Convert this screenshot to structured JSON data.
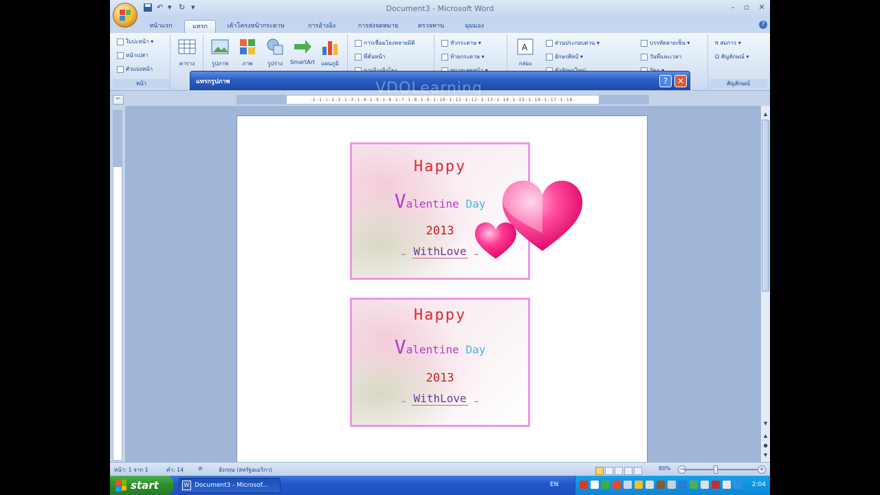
{
  "window": {
    "title": "Document3 - Microsoft Word",
    "minimize": "–",
    "maximize": "▫",
    "close": "✕"
  },
  "qat": {
    "save_icon": "save-icon",
    "undo": "↶",
    "redo": "↻",
    "more": "▾"
  },
  "tabs": [
    {
      "label": "หน้าแรก"
    },
    {
      "label": "แทรก",
      "active": true
    },
    {
      "label": "เค้าโครงหน้ากระดาษ"
    },
    {
      "label": "การอ้างอิง"
    },
    {
      "label": "การส่งจดหมาย"
    },
    {
      "label": "ตรวจทาน"
    },
    {
      "label": "มุมมอง"
    }
  ],
  "ribbon": {
    "pages": {
      "items": [
        "ใบปะหน้า ▾",
        "หน้าเปล่า",
        "ตัวแบ่งหน้า"
      ],
      "label": "หน้า"
    },
    "table": {
      "label": "ตาราง"
    },
    "illustrations": {
      "items": [
        "รูปภาพ",
        "ภาพ",
        "รูปร่าง",
        "SmartArt",
        "แผนภูมิ"
      ]
    },
    "links": {
      "items": [
        "การเชื่อมโยงหลายมิติ",
        "ที่คั่นหน้า",
        "การอ้างอิงโยง"
      ]
    },
    "header_footer": {
      "items": [
        "หัวกระดาษ ▾",
        "ท้ายกระดาษ ▾",
        "หมายเลขหน้า ▾"
      ]
    },
    "text": {
      "textbox": "กล่อง",
      "items": [
        "ส่วนประกอบด่วน ▾",
        "อักษรศิลป์ ▾",
        "ตัวอักษรใหญ่"
      ],
      "items2": [
        "บรรทัดลายเซ็น ▾",
        "วันที่และเวลา",
        "วัตถุ ▾"
      ]
    },
    "symbols": {
      "items": [
        "π สมการ ▾",
        "Ω สัญลักษณ์ ▾"
      ],
      "label": "สัญลักษณ์"
    }
  },
  "dialog": {
    "title": "แทรกรูปภาพ",
    "help": "?",
    "close": "✕"
  },
  "watermark": "VDOLearning",
  "ruler": {
    "ticks": "·2·1·ι·1·2·1·3·1·4·1·5·1·6·1·7·1·8·1·9·1·10·1·11·1·12·1·13·1·14·1·15·1·16·1·17·1·18·"
  },
  "cards": [
    {
      "happy": "Happy",
      "v": "V",
      "alentine": "alentine",
      "day": "Day",
      "year": "2013",
      "with": "WithLove",
      "dash": "…"
    },
    {
      "happy": "Happy",
      "v": "V",
      "alentine": "alentine",
      "day": "Day",
      "year": "2013",
      "with": "WithLove",
      "dash": "…"
    }
  ],
  "status": {
    "page": "หน้า: 1 จาก 1",
    "words": "คำ: 14",
    "language": "อังกฤษ (สหรัฐอเมริกา)",
    "zoom": "80%"
  },
  "taskbar": {
    "start": "start",
    "task_word": "Document3 - Microsof...",
    "lang": "EN",
    "clock": "2:04"
  },
  "colors": {
    "card_border": "#ee95e8",
    "heart": "#ff2f8e",
    "happy": "#e0292e",
    "valentine": "#b23cc8",
    "day": "#42b8e0"
  }
}
